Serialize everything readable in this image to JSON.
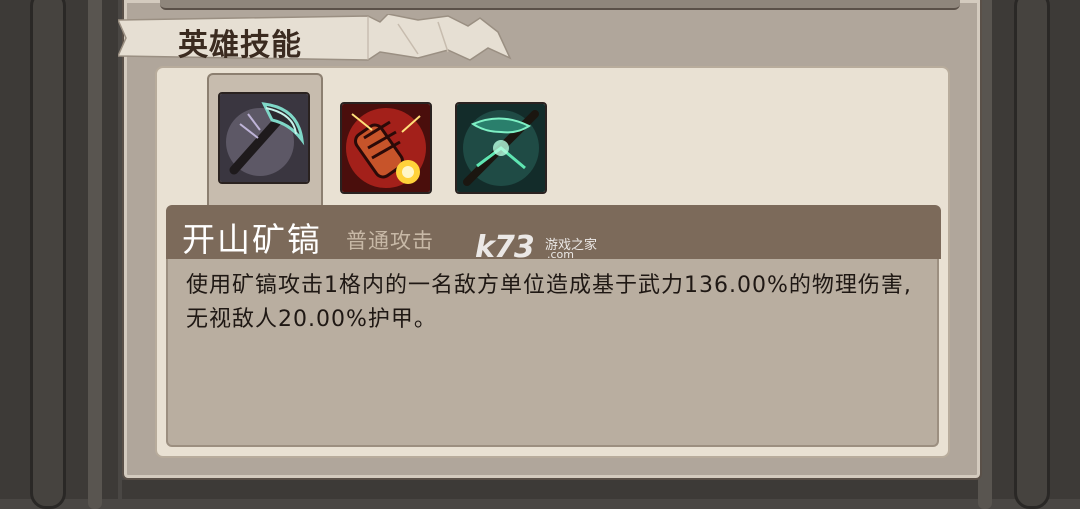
{
  "section": {
    "title": "英雄技能"
  },
  "skills": [
    {
      "icon": "pickaxe-skill-icon",
      "selected": true
    },
    {
      "icon": "explosive-fist-skill-icon",
      "selected": false
    },
    {
      "icon": "green-crossbow-skill-icon",
      "selected": false
    }
  ],
  "selected_skill": {
    "name": "开山矿镐",
    "type": "普通攻击",
    "description": "使用矿镐攻击1格内的一名敌方单位造成基于武力136.00%的物理伤害,无视敌人20.00%护甲。"
  },
  "watermark": {
    "logo": "k73",
    "cn": "游戏之家",
    "domain": ".com"
  },
  "colors": {
    "panel": "#b0a69b",
    "card": "#e9e1d3",
    "header_bar": "#7c6a5a",
    "desc_bg": "#b9aea0"
  }
}
